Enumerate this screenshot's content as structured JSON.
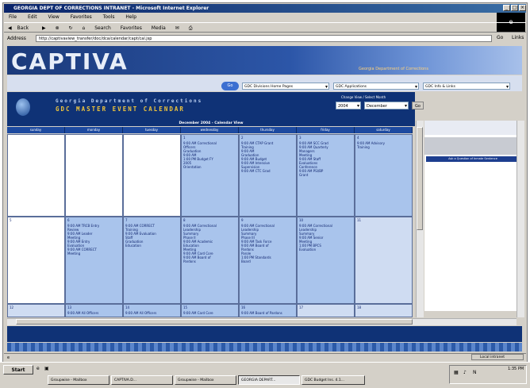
{
  "window": {
    "title": "GEORGIA DEPT OF CORRECTIONS INTRANET - Microsoft Internet Explorer"
  },
  "menu": [
    "File",
    "Edit",
    "View",
    "Favorites",
    "Tools",
    "Help"
  ],
  "toolbar": [
    "Back",
    "Search",
    "Favorites",
    "Media"
  ],
  "address": {
    "label": "Address",
    "value": "http://captivaview_transfer/doc/dca/calendar/capt/cal.jsp",
    "go": "Go",
    "links": "Links"
  },
  "banner": {
    "logo": "CAPTIVA",
    "tagline": "Georgia Department of Corrections"
  },
  "nav_selects": [
    "GDC Divisions Home Pages",
    "GDC Applications",
    "GDC Info & Links"
  ],
  "go_icon_label": "Go",
  "calendar": {
    "dept": "Georgia Department of Corrections",
    "title": "GDC MASTER EVENT CALENDAR",
    "view_label": "Change View / Select Month",
    "year": "2004",
    "month": "December",
    "go": "Go",
    "month_title": "December 2004 - Calendar View",
    "days": [
      "sunday",
      "monday",
      "tuesday",
      "wednesday",
      "thursday",
      "friday",
      "saturday"
    ],
    "weeks": [
      [
        {
          "num": "",
          "events": []
        },
        {
          "num": "",
          "events": []
        },
        {
          "num": "",
          "events": []
        },
        {
          "num": "1",
          "events": [
            "9:00 AM Correctional",
            "Officers",
            "Graduation",
            "9:00 AM",
            "1:00 PM Budget FY",
            "2005",
            "Orientation"
          ]
        },
        {
          "num": "2",
          "events": [
            "9:00 AM CTAP Grant",
            "Training",
            "9:00 AM",
            "Graduation",
            "9:00 AM Budget",
            "9:00 AM Intensive",
            "Supervision",
            "9:00 AM CTC Grad"
          ]
        },
        {
          "num": "3",
          "events": [
            "9:00 AM SCC Grad",
            "9:00 AM Quarterly",
            "Managers",
            "Meeting",
            "9:00 AM Staff",
            "Evaluations",
            "Conference",
            "9:00 AM PSI/BP",
            "Grant"
          ]
        },
        {
          "num": "4",
          "events": [
            "9:00 AM Advisory",
            "Training"
          ]
        }
      ],
      [
        {
          "num": "5",
          "events": []
        },
        {
          "num": "6",
          "events": [
            "9:00 AM TRCB Entry",
            "Review",
            "9:00 AM Leader",
            "Meeting",
            "9:00 AM Entry",
            "Evaluation",
            "9:00 AM CORRECT",
            "Meeting"
          ]
        },
        {
          "num": "7",
          "events": [
            "9:00 AM CORRECT",
            "Training",
            "9:00 AM Evaluation",
            "Staff",
            "Graduation",
            "Education"
          ]
        },
        {
          "num": "8",
          "events": [
            "9:00 AM Correctional",
            "Leadership",
            "Summary",
            "Phase II",
            "9:00 AM Academic",
            "Education",
            "Meeting",
            "9:00 AM Card Core",
            "9:00 AM Board of",
            "Pardons"
          ]
        },
        {
          "num": "9",
          "events": [
            "9:00 AM Correctional",
            "Leadership",
            "Summary",
            "Phase III",
            "9:00 AM Task Force",
            "9:00 AM Board of",
            "Pardons",
            "Parole",
            "1:00 PM Standards",
            "Board"
          ]
        },
        {
          "num": "10",
          "events": [
            "9:00 AM Correctional",
            "Leadership",
            "Summary",
            "9:00 AM Senior",
            "Meeting",
            "1:00 PM BPCS",
            "Evaluation"
          ]
        },
        {
          "num": "11",
          "events": []
        }
      ],
      [
        {
          "num": "12",
          "events": []
        },
        {
          "num": "13",
          "events": [
            "9:00 AM All Officers"
          ]
        },
        {
          "num": "14",
          "events": [
            "9:00 AM All Officers"
          ]
        },
        {
          "num": "15",
          "events": [
            "9:00 AM Card Core"
          ]
        },
        {
          "num": "16",
          "events": [
            "9:00 AM Board of Pardons"
          ]
        },
        {
          "num": "17",
          "events": []
        },
        {
          "num": "18",
          "events": []
        }
      ]
    ]
  },
  "side_panel": {
    "button": "Ask a Question of Inmate Sentence"
  },
  "status": {
    "zone": "Local intranet"
  },
  "taskbar": {
    "start": "Start",
    "tasks": [
      "Groupwise - Mailbox",
      "CAPTIVA.D...",
      "Groupwise - Mailbox",
      "GEORGIA DEPART...",
      "GDC Budget Ins. 4.1..."
    ],
    "clock": "1:35 PM"
  },
  "colors": {
    "banner": "#2c56a8",
    "calendar_header": "#0f3276",
    "cell_filled": "#a9c4ec"
  }
}
